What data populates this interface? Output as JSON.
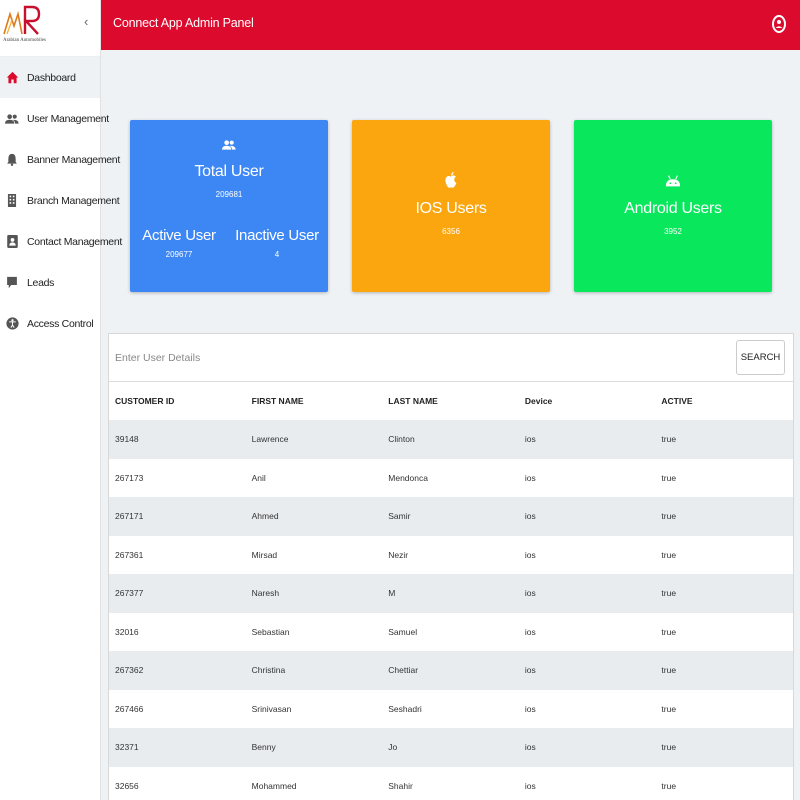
{
  "brand": {
    "logo_text": "AWR",
    "logo_caption": "Arabian Automobiles",
    "collapse_glyph": "‹"
  },
  "colors": {
    "header": "#dc0a2d",
    "card_blue": "#3d87f5",
    "card_orange": "#fba60e",
    "card_green": "#09e85c",
    "active_icon": "#dc0a2d"
  },
  "sidebar": {
    "items": [
      {
        "label": "Dashboard",
        "icon": "home-icon",
        "active": true
      },
      {
        "label": "User Management",
        "icon": "users-icon"
      },
      {
        "label": "Banner Management",
        "icon": "bell-icon"
      },
      {
        "label": "Branch Management",
        "icon": "building-icon"
      },
      {
        "label": "Contact Management",
        "icon": "contact-icon"
      },
      {
        "label": "Leads",
        "icon": "comment-icon"
      },
      {
        "label": "Access Control",
        "icon": "accessibility-icon"
      }
    ]
  },
  "header": {
    "title": "Connect App Admin Panel",
    "user_icon": "user-icon"
  },
  "cards": {
    "total": {
      "title": "Total User",
      "value": "209681",
      "icon": "users-icon"
    },
    "active": {
      "title": "Active User",
      "value": "209677"
    },
    "inactive": {
      "title": "Inactive User",
      "value": "4"
    },
    "ios": {
      "title": "IOS Users",
      "value": "6356",
      "icon": "apple-icon"
    },
    "android": {
      "title": "Android Users",
      "value": "3952",
      "icon": "android-icon"
    }
  },
  "search": {
    "placeholder": "Enter User Details",
    "value": "",
    "button_label": "SEARCH"
  },
  "table": {
    "headers": [
      "CUSTOMER ID",
      "FIRST NAME",
      "LAST NAME",
      "Device",
      "ACTIVE"
    ],
    "rows": [
      [
        "39148",
        "Lawrence",
        "Clinton",
        "ios",
        "true"
      ],
      [
        "267173",
        "Anil",
        "Mendonca",
        "ios",
        "true"
      ],
      [
        "267171",
        "Ahmed",
        "Samir",
        "ios",
        "true"
      ],
      [
        "267361",
        "Mirsad",
        "Nezir",
        "ios",
        "true"
      ],
      [
        "267377",
        "Naresh",
        "M",
        "ios",
        "true"
      ],
      [
        "32016",
        "Sebastian",
        "Samuel",
        "ios",
        "true"
      ],
      [
        "267362",
        "Christina",
        "Chettiar",
        "ios",
        "true"
      ],
      [
        "267466",
        "Srinivasan",
        "Seshadri",
        "ios",
        "true"
      ],
      [
        "32371",
        "Benny",
        "Jo",
        "ios",
        "true"
      ],
      [
        "32656",
        "Mohammed",
        "Shahir",
        "ios",
        "true"
      ]
    ]
  }
}
